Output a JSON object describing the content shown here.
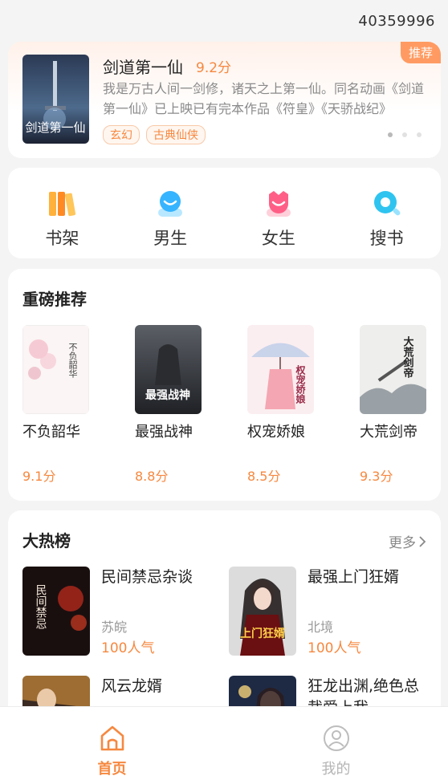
{
  "status": {
    "id_text": "40359996"
  },
  "featured": {
    "tag": "推荐",
    "title": "剑道第一仙",
    "score": "9.2分",
    "description": "我是万古人间一剑修，诸天之上第一仙。同名动画《剑道第一仙》已上映已有完本作品《符皇》《天骄战纪》",
    "chips": [
      "玄幻",
      "古典仙侠"
    ],
    "cover_text": "剑道第一仙"
  },
  "nav": {
    "items": [
      {
        "label": "书架",
        "icon": "bookshelf-icon"
      },
      {
        "label": "男生",
        "icon": "male-icon"
      },
      {
        "label": "女生",
        "icon": "female-icon"
      },
      {
        "label": "搜书",
        "icon": "search-icon"
      }
    ]
  },
  "recommend": {
    "title": "重磅推荐",
    "books": [
      {
        "title": "不负韶华",
        "score": "9.1分",
        "cover_text": "不负韶华"
      },
      {
        "title": "最强战神",
        "score": "8.8分",
        "cover_text": "最强战神"
      },
      {
        "title": "权宠娇娘",
        "score": "8.5分",
        "cover_text": "权宠娇娘"
      },
      {
        "title": "大荒剑帝",
        "score": "9.3分",
        "cover_text": "大荒剑帝"
      }
    ]
  },
  "hot": {
    "title": "大热榜",
    "more": "更多",
    "books": [
      {
        "title": "民间禁忌杂谈",
        "author": "苏皖",
        "popularity": "100人气",
        "cover_text": "民间禁忌"
      },
      {
        "title": "最强上门狂婿",
        "author": "北境",
        "popularity": "100人气",
        "cover_text": "上门狂婿"
      },
      {
        "title": "风云龙婿",
        "author": "",
        "popularity": "",
        "cover_text": ""
      },
      {
        "title": "狂龙出渊,绝色总裁爱上我",
        "author": "",
        "popularity": "",
        "cover_text": ""
      }
    ]
  },
  "tabbar": {
    "items": [
      {
        "label": "首页",
        "active": true
      },
      {
        "label": "我的",
        "active": false
      }
    ]
  },
  "colors": {
    "accent": "#f6883f",
    "tag": "#ff9b62"
  }
}
